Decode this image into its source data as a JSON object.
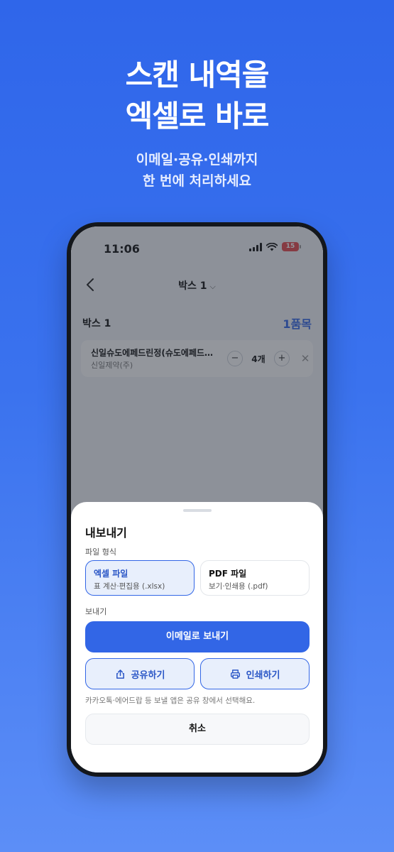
{
  "promo": {
    "headline_line1": "스캔 내역을",
    "headline_line2": "엑셀로 바로",
    "sub_line1": "이메일·공유·인쇄까지",
    "sub_line2": "한 번에 처리하세요"
  },
  "status_bar": {
    "time": "11:06",
    "battery": "15",
    "icons": [
      "cellular-signal-icon",
      "wifi-icon",
      "battery-icon"
    ]
  },
  "nav": {
    "title": "박스 1",
    "title_chevron": "⌵",
    "back_icon": "chevron-left-icon"
  },
  "box": {
    "label": "박스 1",
    "count": "1품목"
  },
  "items": [
    {
      "name": "신일슈도에페드린정(슈도에페드린염산염)",
      "maker": "신일제약(주)",
      "quantity": "4개",
      "minus": "−",
      "plus": "+",
      "remove": "✕"
    }
  ],
  "export_sheet": {
    "title": "내보내기",
    "format_label": "파일 형식",
    "formats": [
      {
        "title": "엑셀 파일",
        "desc": "표 계산·편집용 (.xlsx)",
        "selected": true
      },
      {
        "title": "PDF 파일",
        "desc": "보기·인쇄용 (.pdf)",
        "selected": false
      }
    ],
    "send_label": "보내기",
    "email_button": "이메일로 보내기",
    "share_button": "공유하기",
    "print_button": "인쇄하기",
    "hint": "카카오톡·에어드랍 등 보낼 앱은 공유 창에서 선택해요.",
    "cancel_button": "취소"
  },
  "colors": {
    "accent": "#3266e6",
    "background_top": "#2f66ea",
    "background_bottom": "#5c8ef7",
    "selected_fill": "#e8effc",
    "battery_low": "#e5484d"
  }
}
